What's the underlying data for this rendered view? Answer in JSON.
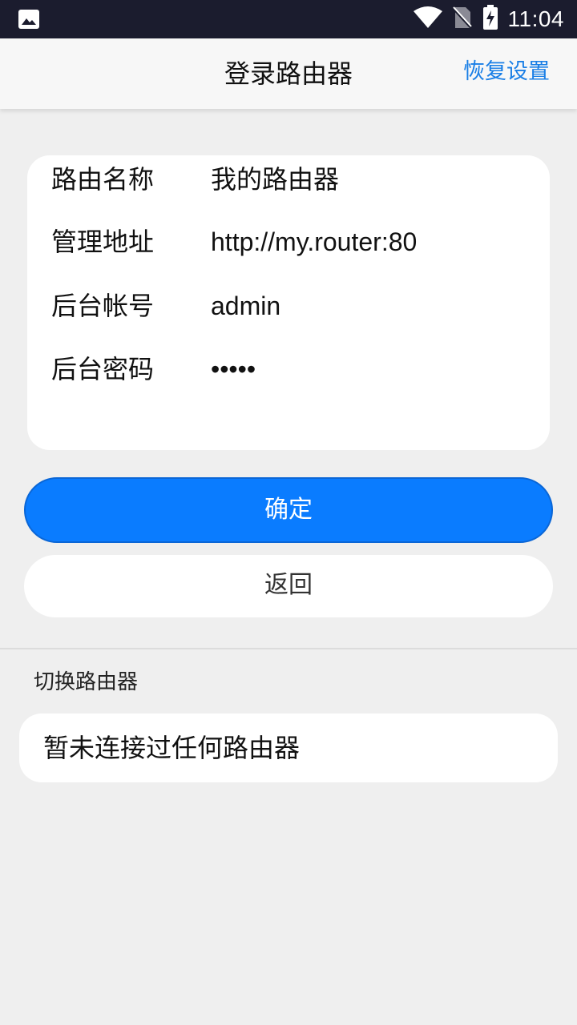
{
  "status_bar": {
    "time": "11:04",
    "icons": [
      "gallery-icon",
      "wifi-icon",
      "no-sim-icon",
      "battery-charging-icon"
    ]
  },
  "toolbar": {
    "title": "登录路由器",
    "restore_label": "恢复设置"
  },
  "router_info": {
    "rows": [
      {
        "label": "路由名称",
        "value": "我的路由器"
      },
      {
        "label": "管理地址",
        "value": "http://my.router:80"
      },
      {
        "label": "后台帐号",
        "value": "admin"
      },
      {
        "label": "后台密码",
        "value": "•••••"
      }
    ]
  },
  "buttons": {
    "confirm_label": "确定",
    "back_label": "返回"
  },
  "switch_section": {
    "title": "切换路由器",
    "empty_message": "暂未连接过任何路由器"
  },
  "colors": {
    "accent": "#0a7cff",
    "link": "#1a7fe6",
    "status_bar": "#1b1c2e",
    "background": "#efefef"
  }
}
